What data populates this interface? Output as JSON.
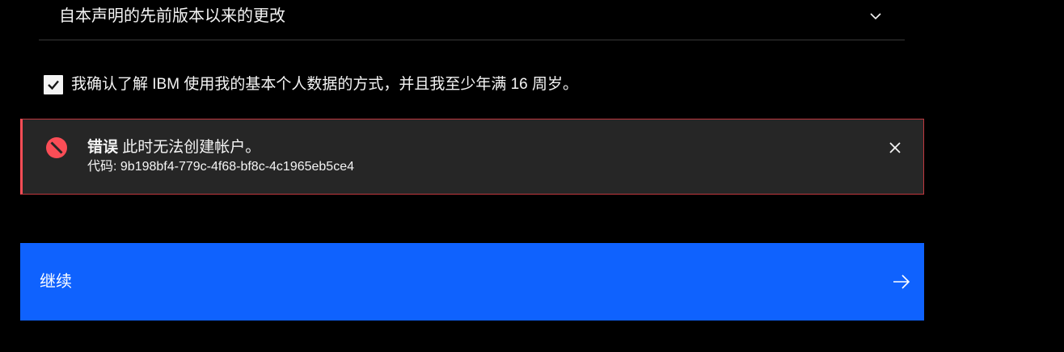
{
  "accordion": {
    "title": "自本声明的先前版本以来的更改",
    "chevron_icon": "chevron-down-icon"
  },
  "consent": {
    "checked": true,
    "label": "我确认了解 IBM 使用我的基本个人数据的方式，并且我至少年满 16 周岁。"
  },
  "notification": {
    "kind": "error",
    "title": "错误",
    "message": "此时无法创建帐户。",
    "code_text": "代码: 9b198bf4-779c-4f68-bf8c-4c1965eb5ce4",
    "icon": "error-filled-icon",
    "close_icon": "close-icon",
    "accent_color": "#fa4d56"
  },
  "primary_button": {
    "label": "继续",
    "icon": "arrow-right-icon",
    "color": "#0f62fe"
  },
  "colors": {
    "background": "#000000",
    "text": "#f4f4f4",
    "notification_bg": "#262626"
  }
}
